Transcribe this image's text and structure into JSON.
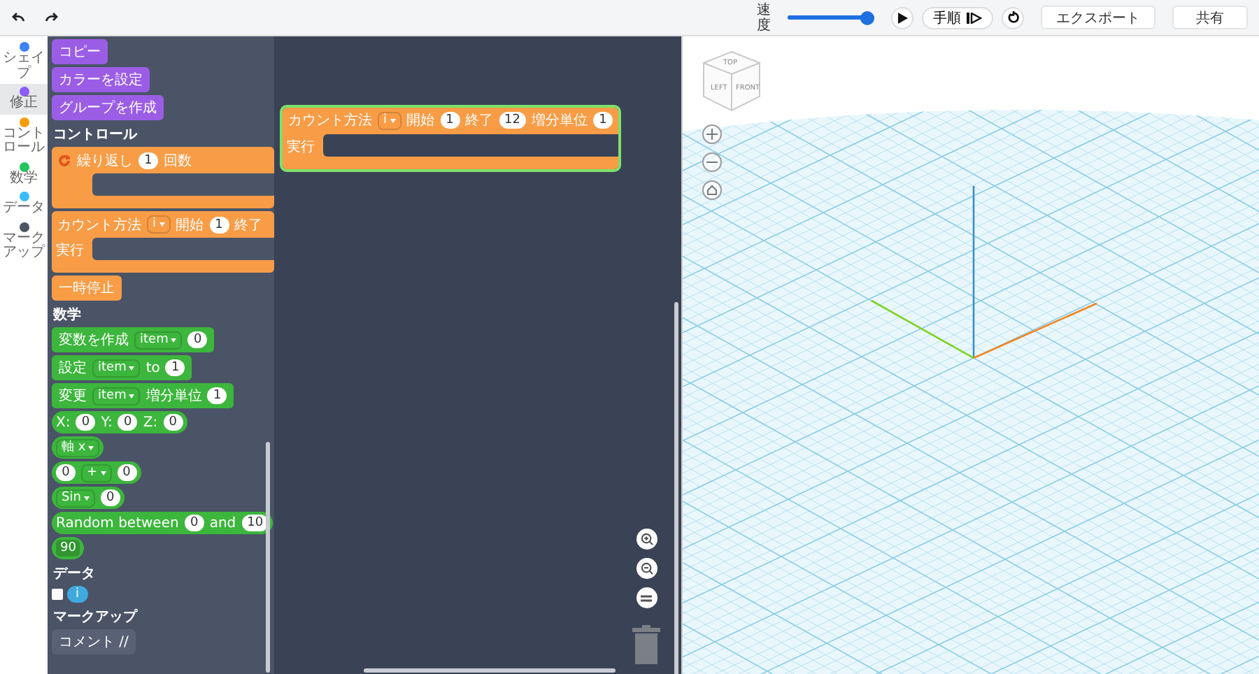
{
  "toolbar": {
    "speed_label": "速度",
    "speed": {
      "level": 1.0
    },
    "step_button": "手順",
    "export_button": "エクスポート",
    "share_button": "共有"
  },
  "categories": [
    {
      "label": "シェイプ",
      "color": "#3b82f6",
      "selected": false
    },
    {
      "label": "修正",
      "color": "#8b5cf6",
      "selected": true
    },
    {
      "label": "コントロール",
      "color": "#f59e0b",
      "selected": false
    },
    {
      "label": "数学",
      "color": "#22c55e",
      "selected": false
    },
    {
      "label": "データ",
      "color": "#38bdf8",
      "selected": false
    },
    {
      "label": "マークアップ",
      "color": "#4b5563",
      "selected": false
    }
  ],
  "palette": [
    {
      "kind": "stack-block",
      "color": "#9b5de5",
      "parts": [
        {
          "kind": "text",
          "text": "コピー"
        }
      ]
    },
    {
      "kind": "stack-block",
      "color": "#9b5de5",
      "parts": [
        {
          "kind": "text",
          "text": "カラーを設定"
        }
      ]
    },
    {
      "kind": "stack-block",
      "color": "#9b5de5",
      "parts": [
        {
          "kind": "text",
          "text": "グループを作成"
        }
      ]
    },
    {
      "kind": "heading",
      "text": "コントロール"
    },
    {
      "kind": "c-block",
      "color": "#f89c46",
      "parts": [
        {
          "kind": "loop-icon"
        },
        {
          "kind": "text",
          "text": "繰り返し"
        },
        {
          "kind": "input",
          "text": "1"
        },
        {
          "kind": "text",
          "text": "回数"
        }
      ]
    },
    {
      "kind": "c-block",
      "color": "#f89c46",
      "mouth_label": "実行",
      "parts": [
        {
          "kind": "text",
          "text": "カウント方法"
        },
        {
          "kind": "dropdown",
          "text": "i"
        },
        {
          "kind": "text",
          "text": "開始"
        },
        {
          "kind": "input",
          "text": "1"
        },
        {
          "kind": "text",
          "text": "終了"
        }
      ]
    },
    {
      "kind": "stack-block",
      "color": "#f89c46",
      "parts": [
        {
          "kind": "text",
          "text": "一時停止"
        }
      ]
    },
    {
      "kind": "heading",
      "text": "数学"
    },
    {
      "kind": "stack-block",
      "color": "#3cb63c",
      "parts": [
        {
          "kind": "text",
          "text": "変数を作成"
        },
        {
          "kind": "dropdown",
          "text": "item"
        },
        {
          "kind": "input",
          "text": "0"
        }
      ]
    },
    {
      "kind": "stack-block",
      "color": "#3cb63c",
      "parts": [
        {
          "kind": "text",
          "text": "設定"
        },
        {
          "kind": "dropdown",
          "text": "item"
        },
        {
          "kind": "text",
          "text": "to"
        },
        {
          "kind": "input",
          "text": "1"
        }
      ]
    },
    {
      "kind": "stack-block",
      "color": "#3cb63c",
      "parts": [
        {
          "kind": "text",
          "text": "変更"
        },
        {
          "kind": "dropdown",
          "text": "item"
        },
        {
          "kind": "text",
          "text": "増分単位"
        },
        {
          "kind": "input",
          "text": "1"
        }
      ]
    },
    {
      "kind": "reporter-block",
      "color": "#3cb63c",
      "parts": [
        {
          "kind": "text",
          "text": "X:"
        },
        {
          "kind": "input",
          "text": "0"
        },
        {
          "kind": "text",
          "text": "Y:"
        },
        {
          "kind": "input",
          "text": "0"
        },
        {
          "kind": "text",
          "text": "Z:"
        },
        {
          "kind": "input",
          "text": "0"
        }
      ]
    },
    {
      "kind": "reporter-block",
      "color": "#3cb63c",
      "parts": [
        {
          "kind": "dropdown",
          "text": "軸 x"
        }
      ]
    },
    {
      "kind": "reporter-block",
      "color": "#3cb63c",
      "parts": [
        {
          "kind": "input",
          "text": "0"
        },
        {
          "kind": "dropdown",
          "text": "+"
        },
        {
          "kind": "input",
          "text": "0"
        }
      ]
    },
    {
      "kind": "reporter-block",
      "color": "#3cb63c",
      "parts": [
        {
          "kind": "dropdown",
          "text": "Sin"
        },
        {
          "kind": "input",
          "text": "0"
        }
      ]
    },
    {
      "kind": "reporter-block",
      "color": "#3cb63c",
      "parts": [
        {
          "kind": "text",
          "text": "Random between"
        },
        {
          "kind": "input",
          "text": "0"
        },
        {
          "kind": "text",
          "text": "and"
        },
        {
          "kind": "input",
          "text": "10"
        }
      ]
    },
    {
      "kind": "reporter-block",
      "color": "#3cb63c",
      "parts": [
        {
          "kind": "field",
          "text": "90"
        }
      ]
    },
    {
      "kind": "heading",
      "text": "データ"
    },
    {
      "kind": "variable",
      "checked": false,
      "text": "i"
    },
    {
      "kind": "heading",
      "text": "マークアップ"
    },
    {
      "kind": "stack-block",
      "color": "#586274",
      "parts": [
        {
          "kind": "text",
          "text": "コメント //"
        }
      ]
    }
  ],
  "workspace": {
    "blocks": [
      {
        "kind": "c-block",
        "color": "#f89c46",
        "selected": true,
        "mouth_label": "実行",
        "parts": [
          {
            "kind": "text",
            "text": "カウント方法"
          },
          {
            "kind": "dropdown",
            "text": "i"
          },
          {
            "kind": "text",
            "text": "開始"
          },
          {
            "kind": "input",
            "text": "1"
          },
          {
            "kind": "text",
            "text": "終了"
          },
          {
            "kind": "input",
            "text": "12"
          },
          {
            "kind": "text",
            "text": "増分単位"
          },
          {
            "kind": "input",
            "text": "1"
          }
        ]
      }
    ]
  },
  "viewport": {
    "cube": {
      "top": "TOP",
      "left": "LEFT",
      "front": "FRONT"
    }
  }
}
